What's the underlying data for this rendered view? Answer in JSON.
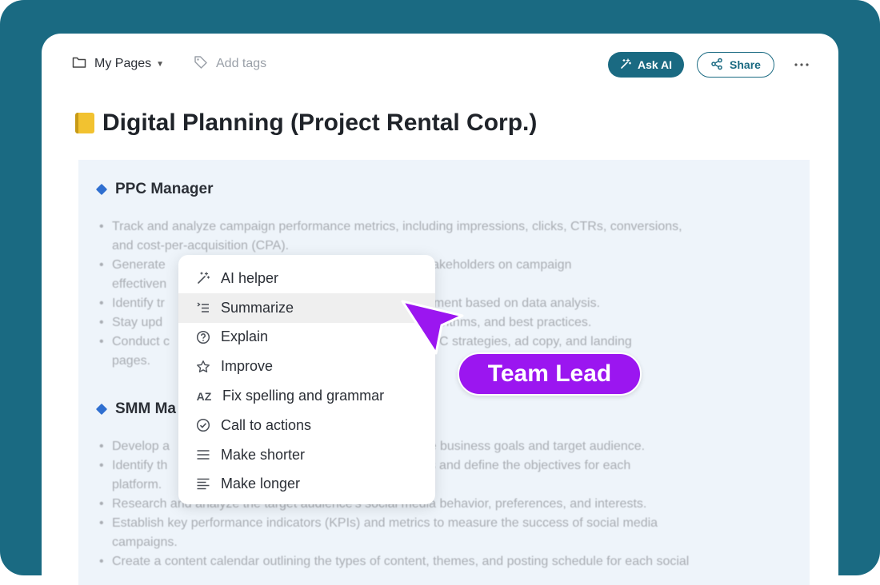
{
  "header": {
    "breadcrumb": "My Pages",
    "tags_placeholder": "Add tags",
    "ask_ai_label": "Ask AI",
    "share_label": "Share",
    "more_icon": "more-horizontal-icon"
  },
  "page": {
    "title": "Digital Planning (Project Rental Corp.)",
    "title_icon": "notebook-emoji"
  },
  "sections": [
    {
      "heading": "PPC Manager",
      "lines": [
        "Track and analyze campaign performance metrics, including impressions, clicks, CTRs, conversions,",
        "and cost-per-acquisition (CPA).",
        "Generate                                                  de insights to stakeholders on campaign",
        "effectiven",
        "Identify tr                                                  mpaign improvement based on data analysis.",
        "Stay upd                                                       platforms, algorithms, and best practices.",
        "Conduct c                                                  erstand their PPC strategies, ad copy, and landing",
        "pages."
      ]
    },
    {
      "heading": "SMM Ma",
      "lines": [
        "Develop a                                                  aligned with the business goals and target audience.",
        "Identify th                                                  for the business and define the objectives for each",
        "platform.",
        "Research and analyze the target audience's social media behavior, preferences, and interests.",
        "Establish key performance indicators (KPIs) and metrics to measure the success of social media",
        "campaigns.",
        "Create a content calendar outlining the types of content, themes, and posting schedule for each social"
      ]
    }
  ],
  "menu": {
    "items": [
      {
        "label": "AI helper",
        "icon": "magic-wand-icon"
      },
      {
        "label": "Summarize",
        "icon": "summarize-list-icon"
      },
      {
        "label": "Explain",
        "icon": "question-circle-icon"
      },
      {
        "label": "Improve",
        "icon": "star-icon"
      },
      {
        "label": "Fix spelling and grammar",
        "icon": "spellcheck-icon"
      },
      {
        "label": "Call to actions",
        "icon": "check-circle-icon"
      },
      {
        "label": "Make shorter",
        "icon": "lines-icon"
      },
      {
        "label": "Make longer",
        "icon": "paragraph-icon"
      }
    ],
    "active_index": 1
  },
  "cursor_badge": "Team Lead",
  "colors": {
    "frame": "#1a6a82",
    "accent": "#1a6a82",
    "badge": "#9b16f0",
    "block_bg": "#eef4fa"
  }
}
